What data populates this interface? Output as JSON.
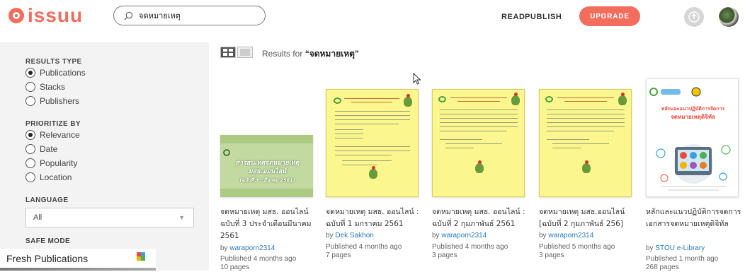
{
  "header": {
    "logo_text": "issuu",
    "search": {
      "value": "จดหมายเหตุ",
      "placeholder": ""
    },
    "nav": {
      "read": "READ",
      "publish": "PUBLISH",
      "upgrade": "UPGRADE"
    },
    "colors": {
      "brand": "#f36d5d"
    }
  },
  "sidebar": {
    "results_type": {
      "title": "RESULTS TYPE",
      "options": [
        {
          "label": "Publications",
          "selected": true
        },
        {
          "label": "Stacks",
          "selected": false
        },
        {
          "label": "Publishers",
          "selected": false
        }
      ]
    },
    "prioritize": {
      "title": "PRIORITIZE BY",
      "options": [
        {
          "label": "Relevance",
          "selected": true
        },
        {
          "label": "Date",
          "selected": false
        },
        {
          "label": "Popularity",
          "selected": false
        },
        {
          "label": "Location",
          "selected": false
        }
      ]
    },
    "language": {
      "title": "LANGUAGE",
      "selected": "All"
    },
    "safe_mode": {
      "title": "SAFE MODE"
    }
  },
  "fresh_publications": {
    "label": "Fresh Publications"
  },
  "results": {
    "prefix": "Results for ",
    "query": "“จดหมายเหตุ”",
    "items": [
      {
        "title": "จดหมายเหตุ มสธ. ออนไลน์ ฉบับที่ 3 ประจำเดือนมีนาคม 2561",
        "by": "by ",
        "author": "waraporn2314",
        "published": "Published 4 months ago",
        "pages": "10 pages",
        "cover_text_1": "สารสนเทศจดหมายเหตุ",
        "cover_text_2": "มสธ.ออนไลน์",
        "cover_text_3": "(ฉบับที่ 3 : มีนาคม 2561)"
      },
      {
        "title": "จดหมายเหตุ มสธ. ออนไลน์ : ฉบับที่ 1 มกราคม 2561",
        "by": "by ",
        "author": "Dek Sakhon",
        "published": "Published 4 months ago",
        "pages": "7 pages"
      },
      {
        "title": "จดหมายเหตุ มสธ. ออนไลน์ : ฉบับที่ 2 กุมภาพันธ์ 2561",
        "by": "by ",
        "author": "waraporn2314",
        "published": "Published 4 months ago",
        "pages": "3 pages"
      },
      {
        "title": "จดหมายเหตุ มสธ.ออนไลน์ [ฉบับที่ 2 กุมภาพันธ์ 256]",
        "by": "by ",
        "author": "waraporn2314",
        "published": "Published 5 months ago",
        "pages": "3 pages"
      },
      {
        "title": "หลักและแนวปฏิบัติการจดการเอกสารจดหมายเหตุดิจิทัล",
        "by": "by ",
        "author": "STOU e-Library",
        "published": "Published 1 month ago",
        "pages": "268 pages",
        "cover_text_1": "หลักและแนวปฏิบัติการจัดการ",
        "cover_text_2": "จดหมายเหตุดิจิทัล"
      }
    ]
  }
}
